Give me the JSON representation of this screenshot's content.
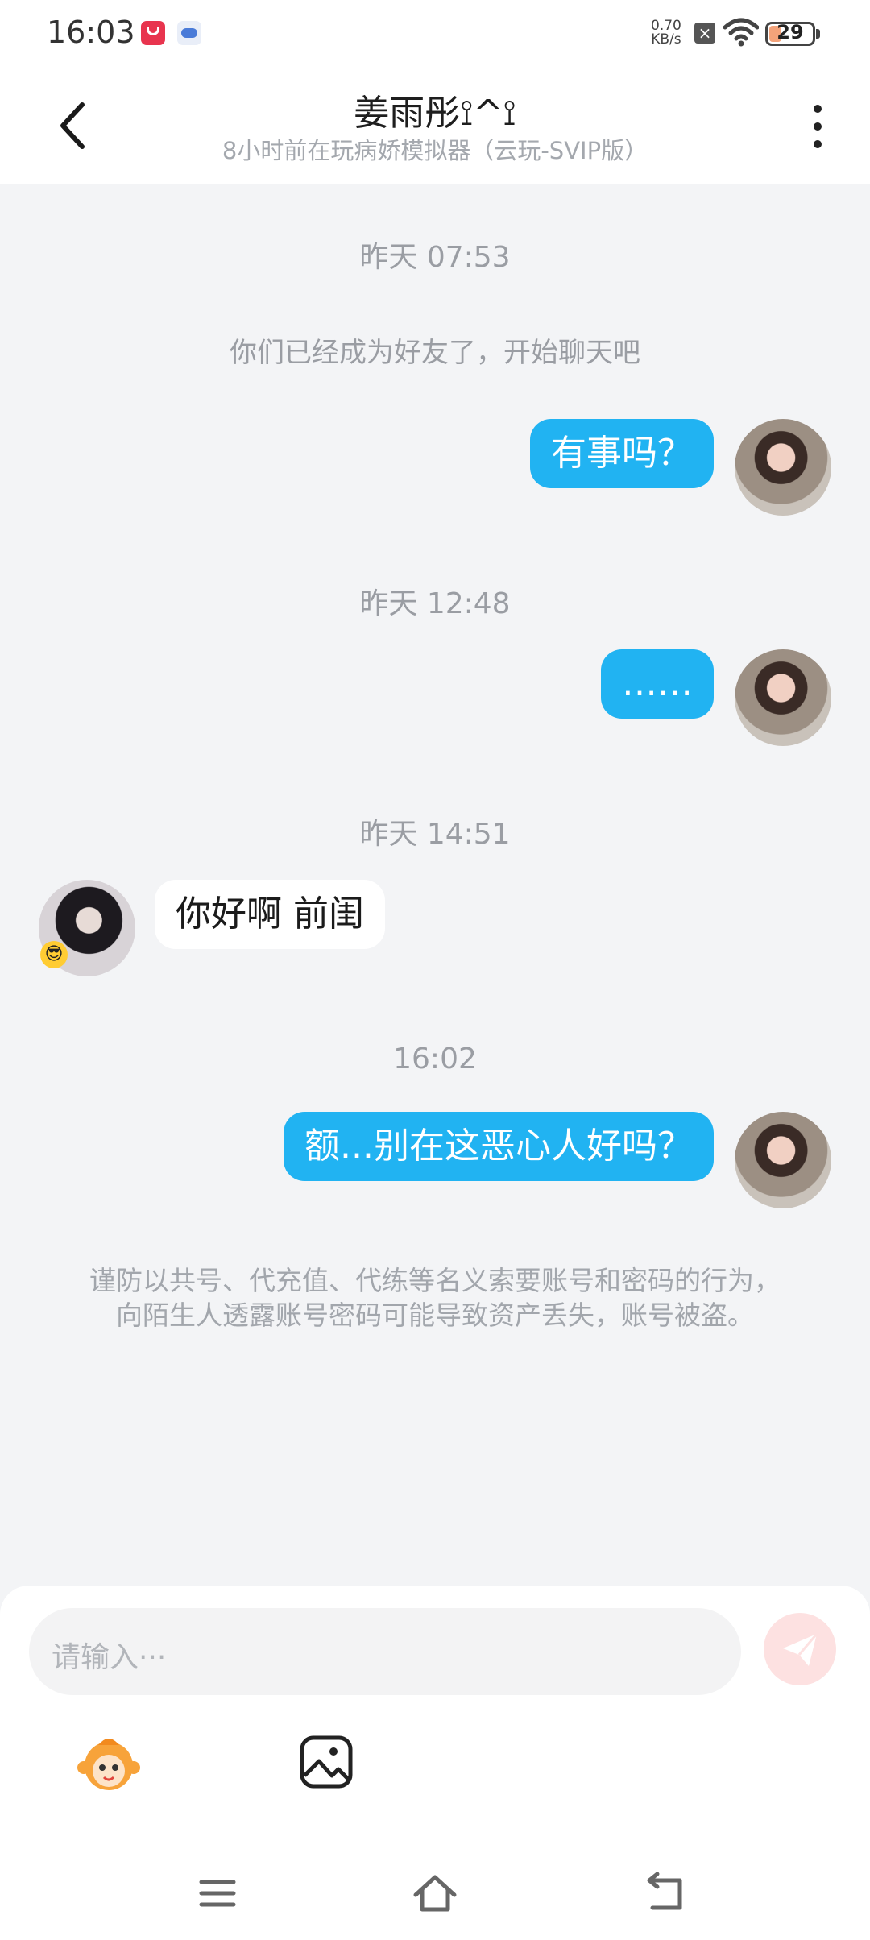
{
  "status_bar": {
    "time": "16:03",
    "net_rate_value": "0.70",
    "net_rate_unit": "KB/s",
    "battery": "29",
    "battery_level": 0.29,
    "icons": [
      "app-notification-icon",
      "robot-app-icon",
      "no-sim-icon",
      "wifi-icon",
      "battery-icon"
    ]
  },
  "header": {
    "title": "姜雨彤⟟^⟟",
    "subtitle": "8小时前在玩病娇模拟器（云玩-SVIP版）"
  },
  "chat": {
    "ts_1": "昨天 07:53",
    "system_note": "你们已经成为好友了，开始聊天吧",
    "msg_1": "有事吗？",
    "ts_2": "昨天 12:48",
    "msg_2": "……",
    "ts_3": "昨天 14:51",
    "msg_3": "你好啊 前闺",
    "ts_4": "16:02",
    "msg_4": "额...别在这恶心人好吗？",
    "warning": "谨防以共号、代充值、代练等名义索要账号和密码的行为，向陌生人透露账号密码可能导致资产丢失，账号被盗。"
  },
  "input": {
    "placeholder": "请输入···"
  },
  "colors": {
    "accent": "#21b3f2",
    "background": "#f3f4f6",
    "send_disabled": "#fde1e1"
  }
}
